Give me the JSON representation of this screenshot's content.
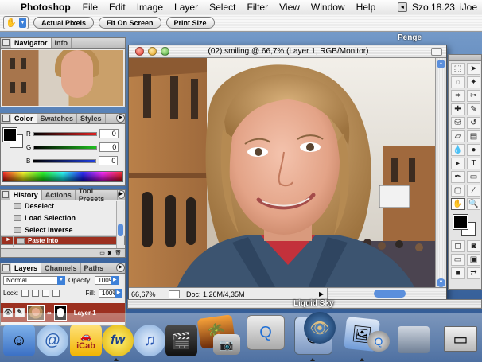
{
  "menubar": {
    "app_name": "Photoshop",
    "menus": [
      "File",
      "Edit",
      "Image",
      "Layer",
      "Select",
      "Filter",
      "View",
      "Window",
      "Help"
    ],
    "clock": "Szo 18.23",
    "user": "iJoe"
  },
  "options_bar": {
    "buttons": [
      "Actual Pixels",
      "Fit On Screen",
      "Print Size"
    ]
  },
  "desktop": {
    "label": "Penge"
  },
  "navigator": {
    "tabs": [
      "Navigator",
      "Info"
    ]
  },
  "color_palette": {
    "tabs": [
      "Color",
      "Swatches",
      "Styles"
    ],
    "channels": [
      {
        "label": "R",
        "value": "0",
        "color": "#e02020"
      },
      {
        "label": "G",
        "value": "0",
        "color": "#20c020"
      },
      {
        "label": "B",
        "value": "0",
        "color": "#2040e0"
      }
    ]
  },
  "history": {
    "tabs": [
      "History",
      "Actions",
      "Tool Presets"
    ],
    "items": [
      "Deselect",
      "Load Selection",
      "Select Inverse",
      "Paste Into"
    ],
    "selected_index": 3
  },
  "layers": {
    "tabs": [
      "Layers",
      "Channels",
      "Paths"
    ],
    "blend_mode": "Normal",
    "opacity_label": "Opacity:",
    "opacity": "100%",
    "lock_label": "Lock:",
    "fill_label": "Fill:",
    "fill": "100%",
    "layer_name": "Layer 1"
  },
  "document": {
    "title": "(02) smiling  @ 66,7% (Layer 1, RGB/Monitor)",
    "zoom": "66,67%",
    "doc_info": "Doc: 1,26M/4,35M"
  },
  "background_window": {
    "title": "Liquid Sky"
  },
  "dock": {
    "items": [
      "finder-icon",
      "mail-icon",
      "icab-icon",
      "fireworks-icon",
      "itunes-icon",
      "imovie-icon",
      "iphoto-icon",
      "camera-icon",
      "quicktime-icon",
      "preview-icon",
      "photoshop-icon",
      "iphoto-album-icon",
      "quicktime-2-icon",
      "system-prefs-icon",
      "trash-window-icon"
    ],
    "icab_label": "iCab"
  },
  "colors": {
    "selected_row": "#9c3020",
    "aqua_blue": "#3d80d8"
  }
}
